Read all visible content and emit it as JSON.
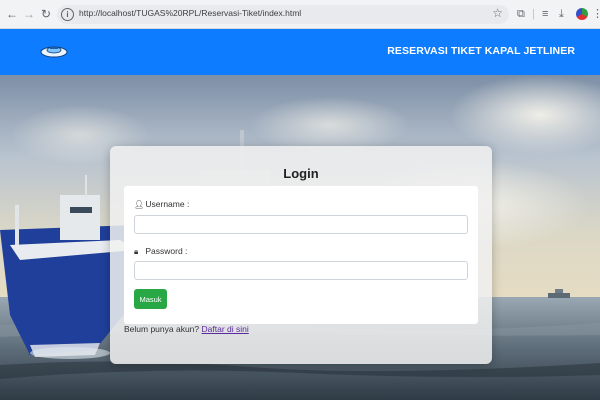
{
  "browser": {
    "url": "http://localhost/TUGAS%20RPL/Reservasi-Tiket/index.html",
    "back_icon": "arrow-left-icon",
    "forward_icon": "arrow-right-icon",
    "reload_icon": "reload-icon"
  },
  "header": {
    "title": "RESERVASI TIKET KAPAL JETLINER",
    "brand_color": "#0d7cff"
  },
  "login": {
    "title": "Login",
    "username_label": "Username :",
    "username_value": "",
    "password_label": "Password :",
    "password_value": "",
    "submit_label": "Masuk",
    "submit_color": "#28a745",
    "register_prompt": "Belum punya akun?",
    "register_link": "Daftar di sini"
  }
}
